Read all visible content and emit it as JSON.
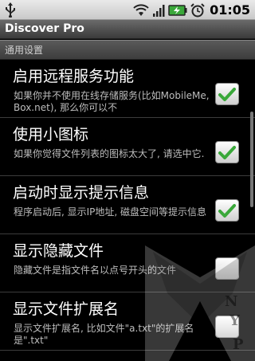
{
  "status_bar": {
    "time": "01:05",
    "icons": [
      "usb-icon",
      "wifi-icon",
      "signal-icon",
      "battery-charging-icon",
      "alarm-icon"
    ]
  },
  "app": {
    "title": "Discover Pro"
  },
  "section": {
    "label": "通用设置"
  },
  "items": [
    {
      "title": "启用远程服务功能",
      "summary": "如果你并不使用在线存储服务(比如MobileMe, Box.net), 那么你可以不",
      "checked": true
    },
    {
      "title": "使用小图标",
      "summary": "如果你觉得文件列表的图标太大了, 请选中它.",
      "checked": true
    },
    {
      "title": "启动时显示提示信息",
      "summary": "程序启动后, 显示IP地址, 磁盘空间等提示信息",
      "checked": true
    },
    {
      "title": "显示隐藏文件",
      "summary": "隐藏文件是指文件名以点号开头的文件",
      "checked": false
    },
    {
      "title": "显示文件扩展名",
      "summary": "显示文件扩展名, 比如文件\"a.txt\"的扩展名是\".txt\"",
      "checked": false
    }
  ],
  "watermark": {
    "letters": [
      "N",
      "Y",
      "P"
    ]
  },
  "colors": {
    "check_green": "#3aa83a",
    "status_bar_bg": "#d8d8d8",
    "title_bar_bg": "#4a4a4a"
  }
}
